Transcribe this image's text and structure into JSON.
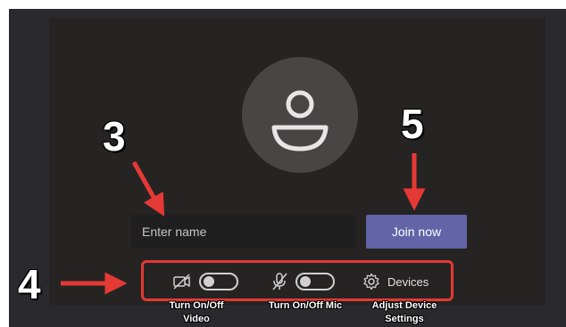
{
  "join_screen": {
    "name_placeholder": "Enter name",
    "join_button_label": "Join now",
    "devices_label": "Devices",
    "video_toggle_on": false,
    "mic_toggle_on": false
  },
  "annotations": {
    "numbers": [
      "3",
      "4",
      "5"
    ],
    "captions": {
      "video": "Turn On/Off Video",
      "mic": "Turn On/Off Mic",
      "devices": "Adjust Device Settings"
    },
    "arrow_color": "#e53935"
  },
  "colors": {
    "join_button": "#6264a7",
    "panel_bg": "#252423",
    "highlight_box": "#e53935"
  },
  "icons": [
    "person-icon",
    "video-off-icon",
    "mic-off-icon",
    "gear-icon"
  ]
}
